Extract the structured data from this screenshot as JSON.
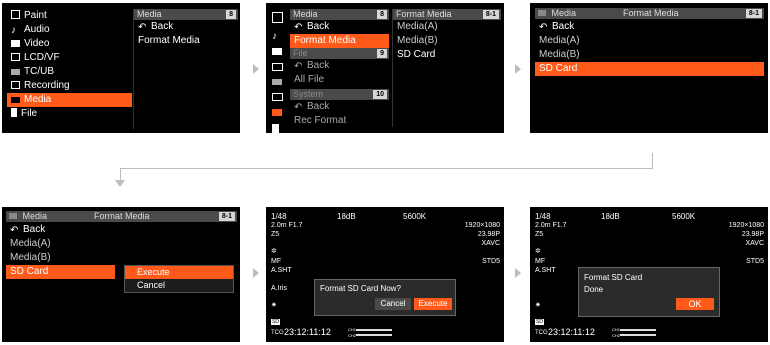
{
  "screen1": {
    "sidebar": [
      {
        "icon": "paint-icon",
        "label": "Paint"
      },
      {
        "icon": "audio-icon",
        "label": "Audio"
      },
      {
        "icon": "video-icon",
        "label": "Video"
      },
      {
        "icon": "lcd-vf-icon",
        "label": "LCD/VF"
      },
      {
        "icon": "tc-ub-icon",
        "label": "TC/UB"
      },
      {
        "icon": "recording-icon",
        "label": "Recording"
      },
      {
        "icon": "media-icon",
        "label": "Media"
      },
      {
        "icon": "file-icon",
        "label": "File"
      }
    ],
    "panel_title": "Media",
    "panel_badge": "8",
    "items": [
      "Back",
      "Format Media"
    ]
  },
  "screen2": {
    "sections": [
      {
        "title": "Media",
        "badge": "8",
        "items": [
          "Back",
          "Format Media"
        ]
      },
      {
        "title": "File",
        "badge": "9",
        "items": [
          "Back",
          "All File"
        ]
      },
      {
        "title": "System",
        "badge": "10",
        "items": [
          "Back",
          "Rec Format"
        ]
      }
    ],
    "right_title": "Format Media",
    "right_badge": "8-1",
    "right_items": [
      "Media(A)",
      "Media(B)",
      "SD Card"
    ]
  },
  "screen3": {
    "title_left": "Media",
    "title_right": "Format Media",
    "badge": "8-1",
    "items": [
      "Back",
      "Media(A)",
      "Media(B)",
      "SD Card"
    ]
  },
  "screen4": {
    "title_left": "Media",
    "title_right": "Format Media",
    "badge": "8-1",
    "items": [
      "Back",
      "Media(A)",
      "Media(B)",
      "SD Card"
    ],
    "popup": [
      "Execute",
      "Cancel"
    ]
  },
  "screen5": {
    "shutter": "1/48",
    "gain": "18dB",
    "wb": "5600K",
    "iris": "2.0m F1.7",
    "z": "Z5",
    "res": "1920×1080",
    "fps": "23.98P",
    "codec": "XAVC",
    "mf": "MF",
    "ashut": "A.SHT",
    "std": "STD5",
    "airis": "A.Iris",
    "tc_label": "TCG",
    "tc": "23:12:11:12",
    "ch1": "CH1",
    "ch2": "CH2",
    "dialog_text": "Format SD Card Now?",
    "cancel": "Cancel",
    "execute": "Execute"
  },
  "screen6": {
    "shutter": "1/48",
    "gain": "18dB",
    "wb": "5600K",
    "iris": "2.0m F1.7",
    "z": "Z5",
    "res": "1920×1080",
    "fps": "23.98P",
    "codec": "XAVC",
    "mf": "MF",
    "ashut": "A.SHT",
    "std": "STD5",
    "tc_label": "TCG",
    "tc": "23:12:11:12",
    "ch1": "CH1",
    "ch2": "CH2",
    "dialog_line1": "Format SD Card",
    "dialog_line2": "Done",
    "ok": "OK"
  },
  "colors": {
    "accent": "#ff5a1a",
    "arrow": "#bdbdbd",
    "bar": "#4a4a4a"
  }
}
